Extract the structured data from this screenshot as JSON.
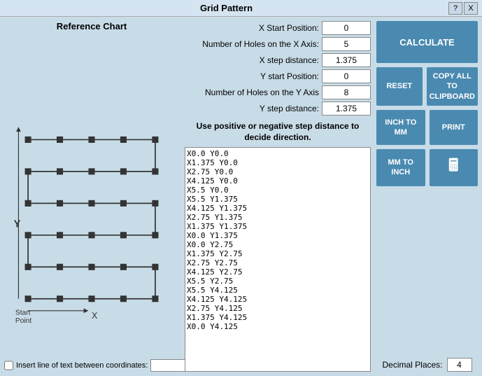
{
  "title": "Grid Pattern",
  "title_buttons": {
    "help": "?",
    "close": "X"
  },
  "reference_chart": {
    "label": "Reference Chart"
  },
  "form": {
    "x_start_label": "X Start Position:",
    "x_start_value": "0",
    "x_holes_label": "Number of Holes on the X Axis:",
    "x_holes_value": "5",
    "x_step_label": "X step distance:",
    "x_step_value": "1.375",
    "y_start_label": "Y start Position:",
    "y_start_value": "0",
    "y_holes_label": "Number of Holes on the Y Axis",
    "y_holes_value": "8",
    "y_step_label": "Y step distance:",
    "y_step_value": "1.375"
  },
  "direction_note": "Use positive or negative step distance to decide direction.",
  "coordinates": "X0.0 Y0.0\nX1.375 Y0.0\nX2.75 Y0.0\nX4.125 Y0.0\nX5.5 Y0.0\nX5.5 Y1.375\nX4.125 Y1.375\nX2.75 Y1.375\nX1.375 Y1.375\nX0.0 Y1.375\nX0.0 Y2.75\nX1.375 Y2.75\nX2.75 Y2.75\nX4.125 Y2.75\nX5.5 Y2.75\nX5.5 Y4.125\nX4.125 Y4.125\nX2.75 Y4.125\nX1.375 Y4.125\nX0.0 Y4.125",
  "buttons": {
    "calculate": "CALCULATE",
    "reset": "RESET",
    "copy_all": "COPY ALL TO CLIPBOARD",
    "inch_to_mm": "INCH TO MM",
    "print": "PRINT",
    "mm_to_inch": "MM TO INCH"
  },
  "decimal": {
    "label": "Decimal Places:",
    "value": "4"
  },
  "insert_line": {
    "label": "Insert line of text between coordinates:",
    "value": "",
    "placeholder": ""
  },
  "icons": {
    "calculator": "🖩"
  }
}
